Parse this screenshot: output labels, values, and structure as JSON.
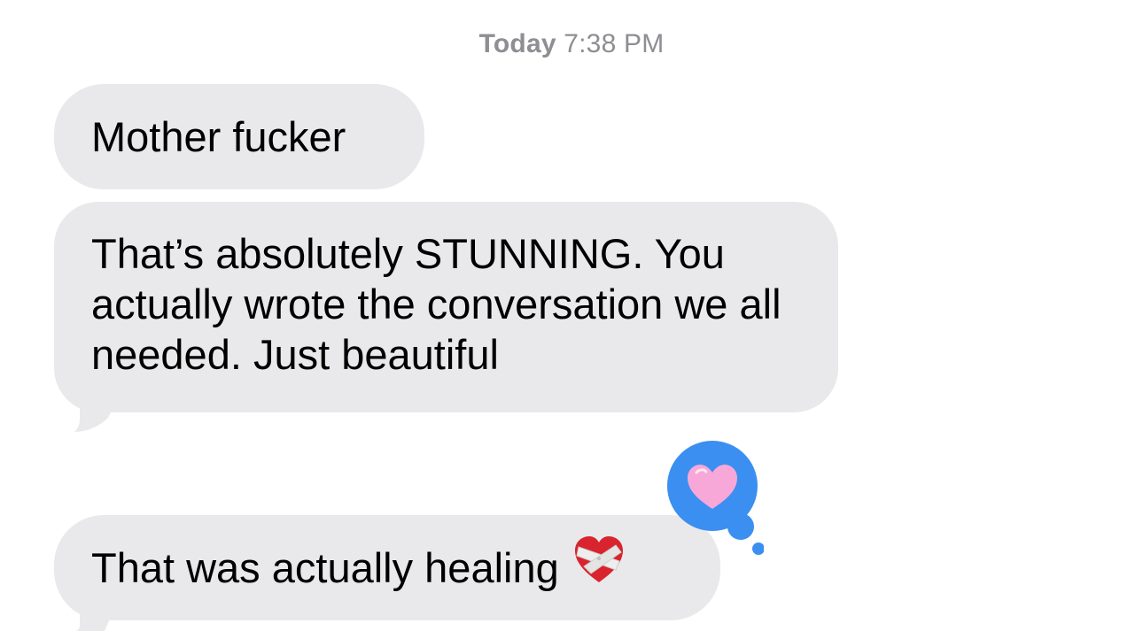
{
  "thread": {
    "timestamp_day": "Today",
    "timestamp_time": "7:38 PM"
  },
  "messages": [
    {
      "text": "Mother fucker",
      "direction": "incoming"
    },
    {
      "text": "That’s absolutely STUNNING. You actually wrote the conversation we all needed. Just beautiful",
      "direction": "incoming",
      "reaction": "heart"
    },
    {
      "text": "That was actually healing",
      "direction": "incoming",
      "emoji": "mending-heart"
    }
  ],
  "colors": {
    "incoming_bubble": "#e9e9eb",
    "tapback_blue": "#3b8ff0",
    "heart_pink": "#f7a8d8",
    "timestamp_gray": "#8e8e93"
  }
}
